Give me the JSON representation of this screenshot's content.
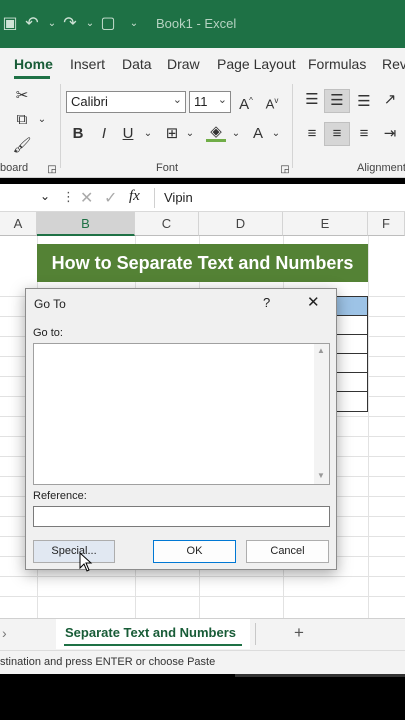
{
  "titlebar": {
    "title": "Book1  -  Excel"
  },
  "tabs": [
    "Home",
    "Insert",
    "Data",
    "Draw",
    "Page Layout",
    "Formulas",
    "Revi"
  ],
  "ribbon": {
    "font_name": "Calibri",
    "font_size": "11",
    "group_clipboard": "board",
    "group_font": "Font",
    "group_alignment": "Alignment"
  },
  "formula_bar": {
    "fx": "fx",
    "value": "Vipin"
  },
  "columns": [
    "A",
    "B",
    "C",
    "D",
    "E",
    "F"
  ],
  "sheet": {
    "banner": "How to Separate Text and Numbers"
  },
  "dialog": {
    "title": "Go To",
    "help": "?",
    "goto_label": "Go to:",
    "reference_label": "Reference:",
    "reference_value": "",
    "buttons": {
      "special": "Special...",
      "ok": "OK",
      "cancel": "Cancel"
    }
  },
  "sheet_tabs": {
    "active": "Separate Text and Numbers",
    "add": "+"
  },
  "status": {
    "message": "stination and press ENTER or choose Paste"
  },
  "colors": {
    "excel_green": "#1e7145",
    "banner_green": "#548235",
    "header_blue": "#9dc3e6"
  }
}
